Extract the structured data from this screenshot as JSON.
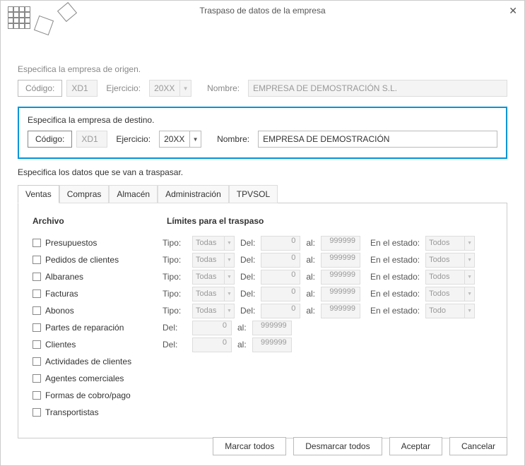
{
  "title": "Traspaso de datos de la empresa",
  "origin": {
    "heading": "Especifica la empresa de origen.",
    "code_label": "Código:",
    "code": "XD1",
    "ejercicio_label": "Ejercicio:",
    "ejercicio": "20XX",
    "nombre_label": "Nombre:",
    "nombre": "EMPRESA DE DEMOSTRACIÓN S.L."
  },
  "dest": {
    "heading": "Especifica la empresa de destino.",
    "code_label": "Código:",
    "code": "XD1",
    "ejercicio_label": "Ejercicio:",
    "ejercicio": "20XX",
    "nombre_label": "Nombre:",
    "nombre": "EMPRESA DE DEMOSTRACIÓN"
  },
  "transfer_heading": "Especifica los datos que se van a traspasar.",
  "tabs": [
    "Ventas",
    "Compras",
    "Almacén",
    "Administración",
    "TPVSOL"
  ],
  "col_headers": {
    "left": "Archivo",
    "right": "Límites para el traspaso"
  },
  "labels": {
    "tipo": "Tipo:",
    "del": "Del:",
    "al": "al:",
    "estado": "En el estado:"
  },
  "rows": [
    {
      "name": "Presupuestos",
      "hasTipo": true,
      "hasEstado": true,
      "tipo": "Todas",
      "del": "0",
      "al": "999999",
      "estado": "Todos"
    },
    {
      "name": "Pedidos de clientes",
      "hasTipo": true,
      "hasEstado": true,
      "tipo": "Todas",
      "del": "0",
      "al": "999999",
      "estado": "Todos"
    },
    {
      "name": "Albaranes",
      "hasTipo": true,
      "hasEstado": true,
      "tipo": "Todas",
      "del": "0",
      "al": "999999",
      "estado": "Todos"
    },
    {
      "name": "Facturas",
      "hasTipo": true,
      "hasEstado": true,
      "tipo": "Todas",
      "del": "0",
      "al": "999999",
      "estado": "Todos"
    },
    {
      "name": "Abonos",
      "hasTipo": true,
      "hasEstado": true,
      "tipo": "Todas",
      "del": "0",
      "al": "999999",
      "estado": "Todo"
    },
    {
      "name": "Partes de reparación",
      "hasTipo": false,
      "hasEstado": false,
      "del": "0",
      "al": "999999"
    },
    {
      "name": "Clientes",
      "hasTipo": false,
      "hasEstado": false,
      "del": "0",
      "al": "999999"
    },
    {
      "name": "Actividades de clientes"
    },
    {
      "name": "Agentes comerciales"
    },
    {
      "name": "Formas de cobro/pago"
    },
    {
      "name": "Transportistas"
    }
  ],
  "buttons": {
    "marcar": "Marcar todos",
    "desmarcar": "Desmarcar todos",
    "aceptar": "Aceptar",
    "cancelar": "Cancelar"
  }
}
